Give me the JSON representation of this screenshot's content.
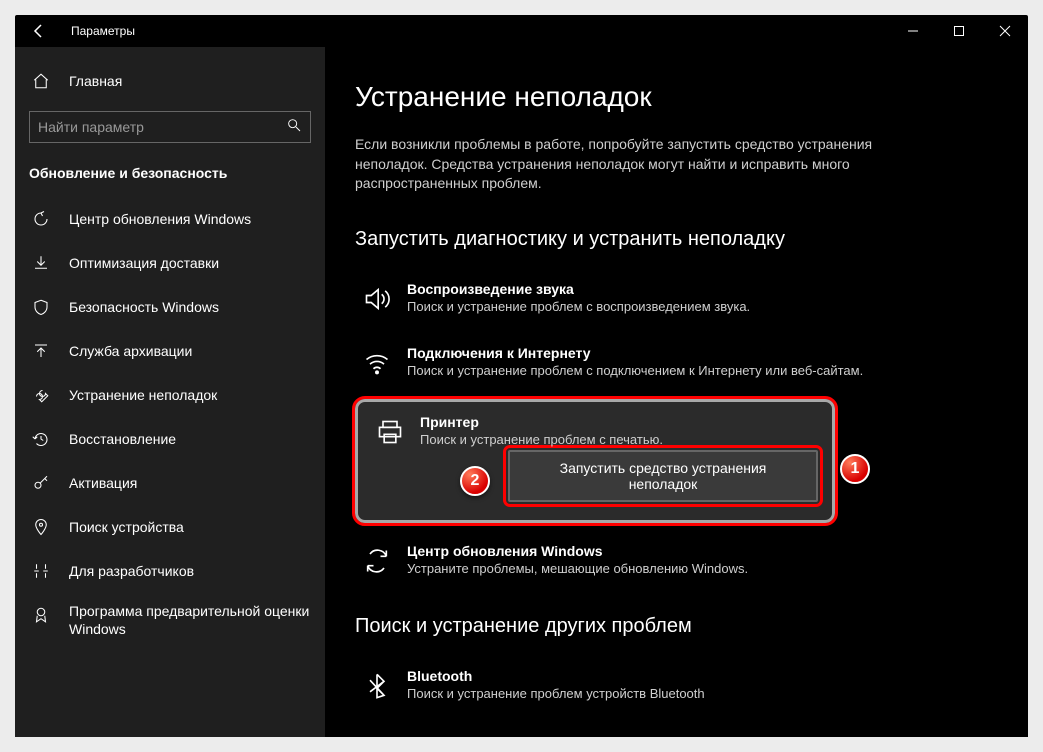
{
  "titlebar": {
    "title": "Параметры"
  },
  "sidebar": {
    "home_label": "Главная",
    "search_placeholder": "Найти параметр",
    "section_label": "Обновление и безопасность",
    "items": [
      {
        "id": "windows-update",
        "label": "Центр обновления Windows"
      },
      {
        "id": "delivery-optimization",
        "label": "Оптимизация доставки"
      },
      {
        "id": "windows-security",
        "label": "Безопасность Windows"
      },
      {
        "id": "backup",
        "label": "Служба архивации"
      },
      {
        "id": "troubleshoot",
        "label": "Устранение неполадок"
      },
      {
        "id": "recovery",
        "label": "Восстановление"
      },
      {
        "id": "activation",
        "label": "Активация"
      },
      {
        "id": "find-my-device",
        "label": "Поиск устройства"
      },
      {
        "id": "for-developers",
        "label": "Для разработчиков"
      },
      {
        "id": "insider",
        "label": "Программа предварительной оценки Windows"
      }
    ]
  },
  "main": {
    "heading": "Устранение неполадок",
    "intro": "Если возникли проблемы в работе, попробуйте запустить средство устранения неполадок. Средства устранения неполадок могут найти и исправить много распространенных проблем.",
    "section1": "Запустить диагностику и устранить неполадку",
    "items": [
      {
        "id": "audio",
        "title": "Воспроизведение звука",
        "desc": "Поиск и устранение проблем с воспроизведением звука."
      },
      {
        "id": "internet",
        "title": "Подключения к Интернету",
        "desc": "Поиск и устранение проблем с подключением к Интернету или веб-сайтам."
      },
      {
        "id": "printer",
        "title": "Принтер",
        "desc": "Поиск и устранение проблем с печатью."
      },
      {
        "id": "windows-update",
        "title": "Центр обновления Windows",
        "desc": "Устраните проблемы, мешающие обновлению Windows."
      }
    ],
    "run_button": "Запустить средство устранения неполадок",
    "section2": "Поиск и устранение других проблем",
    "other": [
      {
        "id": "bluetooth",
        "title": "Bluetooth",
        "desc": "Поиск и устранение проблем устройств Bluetooth"
      }
    ],
    "badges": {
      "one": "1",
      "two": "2"
    }
  }
}
